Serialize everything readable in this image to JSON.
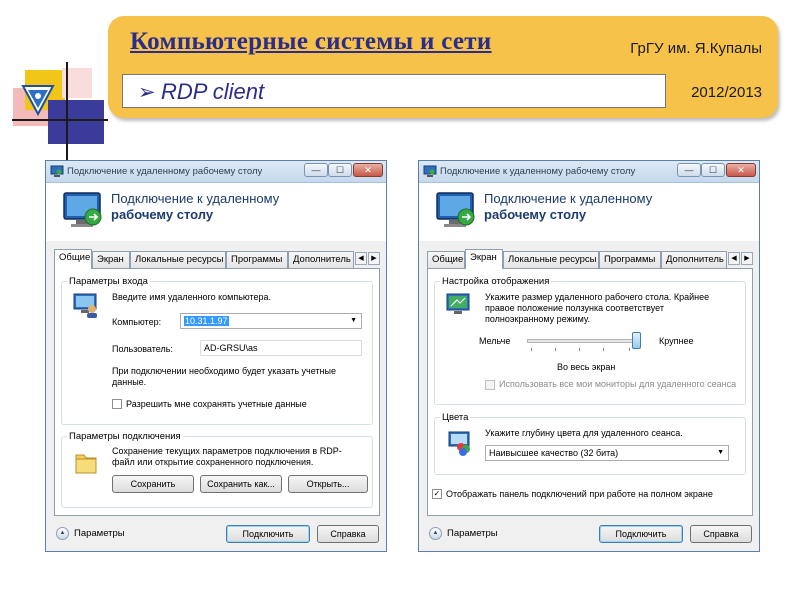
{
  "slide": {
    "title": "Компьютерные системы и сети",
    "university": "ГрГУ им. Я.Купалы",
    "topic_arrow": "➢",
    "topic": "RDP client",
    "year": "2012/2013"
  },
  "left_window": {
    "title": "Подключение к удаленному рабочему столу",
    "header_line1": "Подключение к удаленному",
    "header_line2": "рабочему столу",
    "tabs": [
      "Общие",
      "Экран",
      "Локальные ресурсы",
      "Программы",
      "Дополнитель"
    ],
    "active_tab": "Общие",
    "login_group": {
      "label": "Параметры входа",
      "prompt": "Введите имя удаленного компьютера.",
      "computer_label": "Компьютер:",
      "computer_value": "10.31.1.97",
      "user_label": "Пользователь:",
      "user_value": "AD-GRSU\\as",
      "note": "При подключении необходимо будет указать учетные данные.",
      "save_creds_label": "Разрешить мне сохранять учетные данные"
    },
    "connection_group": {
      "label": "Параметры подключения",
      "description": "Сохранение текущих параметров подключения в RDP-файл или открытие сохраненного подключения.",
      "save_button": "Сохранить",
      "save_as_button": "Сохранить как...",
      "open_button": "Открыть..."
    },
    "footer": {
      "options_label": "Параметры",
      "connect_button": "Подключить",
      "help_button": "Справка"
    }
  },
  "right_window": {
    "title": "Подключение к удаленному рабочему столу",
    "header_line1": "Подключение к удаленному",
    "header_line2": "рабочему столу",
    "tabs": [
      "Общие",
      "Экран",
      "Локальные ресурсы",
      "Программы",
      "Дополнитель"
    ],
    "active_tab": "Экран",
    "display_group": {
      "label": "Настройка отображения",
      "description": "Укажите размер удаленного рабочего стола. Крайнее правое положение ползунка соответствует полноэкранному режиму.",
      "smaller_label": "Мельче",
      "larger_label": "Крупнее",
      "slider_value": 1.0,
      "slider_value_label": "Во весь экран",
      "multimon_label": "Использовать все мои мониторы для удаленного сеанса"
    },
    "colors_group": {
      "label": "Цвета",
      "description": "Укажите глубину цвета для удаленного сеанса.",
      "color_depth_value": "Наивысшее качество (32 бита)"
    },
    "show_bar_label": "Отображать панель подключений при работе на полном экране",
    "footer": {
      "options_label": "Параметры",
      "connect_button": "Подключить",
      "help_button": "Справка"
    }
  },
  "icons": {
    "window_min": "—",
    "window_max": "☐",
    "window_close": "✕",
    "scroll_left": "◀",
    "scroll_right": "▶",
    "dropdown": "▼",
    "options_toggle": "▲",
    "checked": "✓"
  },
  "colors": {
    "banner": "#f6c24a",
    "title_blue": "#2a2c8e",
    "header_blue": "#1c3b6e",
    "selection": "#3399ff"
  }
}
